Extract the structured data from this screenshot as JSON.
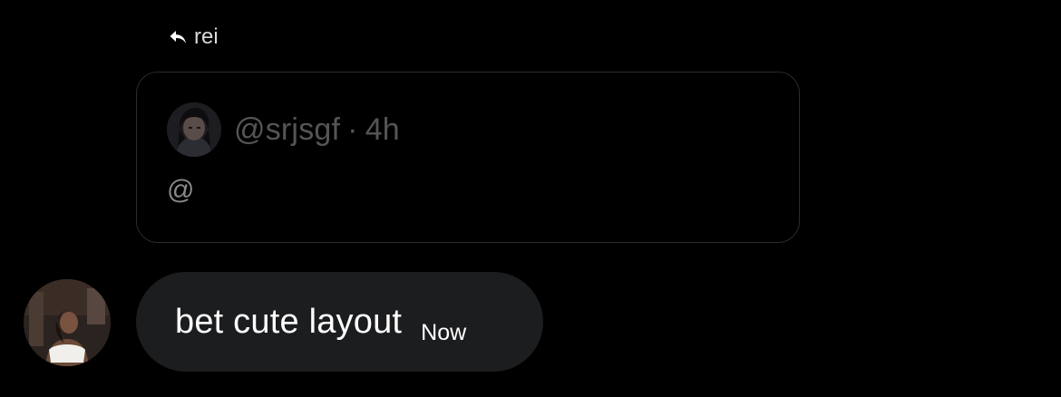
{
  "reply": {
    "icon": "reply-arrow-icon",
    "to": "rei"
  },
  "quoted_message": {
    "handle": "@srjsgf",
    "separator": "·",
    "age": "4h",
    "text": "@",
    "avatar_icon": "anime-character-avatar"
  },
  "message": {
    "text": "bet cute layout",
    "time": "Now",
    "avatar_icon": "user-photo-avatar",
    "bubble_color": "#1c1d1f"
  },
  "colors": {
    "background": "#000000",
    "card_border": "#2b2b2b",
    "muted_text": "#555555"
  }
}
